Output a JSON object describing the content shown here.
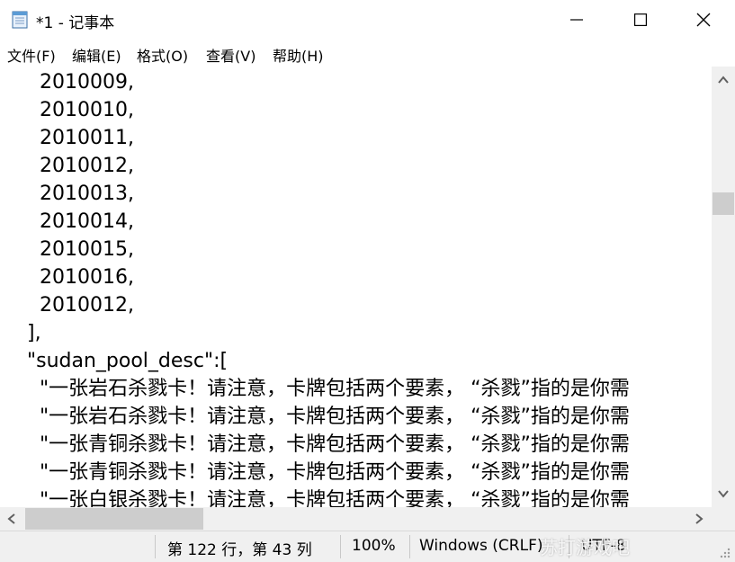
{
  "window": {
    "title": "*1 - 记事本",
    "icon": "notepad-icon",
    "minimize_icon": "minimize-icon",
    "maximize_icon": "maximize-icon",
    "close_icon": "close-icon"
  },
  "menu": {
    "items": [
      "文件(F)",
      "编辑(E)",
      "格式(O)",
      "查看(V)",
      "帮助(H)"
    ]
  },
  "editor": {
    "lines": [
      "    2010009,",
      "    2010010,",
      "    2010011,",
      "    2010012,",
      "    2010013,",
      "    2010014,",
      "    2010015,",
      "    2010016,",
      "    2010012,",
      "  ],",
      "  \"sudan_pool_desc\":[",
      "    \"一张岩石杀戮卡！请注意，卡牌包括两个要素， “杀戮”指的是你需",
      "    \"一张岩石杀戮卡！请注意，卡牌包括两个要素， “杀戮”指的是你需",
      "    \"一张青铜杀戮卡！请注意，卡牌包括两个要素， “杀戮”指的是你需",
      "    \"一张青铜杀戮卡！请注意，卡牌包括两个要素， “杀戮”指的是你需",
      "    \"一张白银杀戮卡！请注意，卡牌包括两个要素， “杀戮”指的是你需"
    ]
  },
  "statusbar": {
    "position": "第 122 行，第 43 列",
    "zoom": "100%",
    "line_ending": "Windows (CRLF)",
    "encoding": "UTF-8",
    "watermark": "苏打游戏吧"
  }
}
